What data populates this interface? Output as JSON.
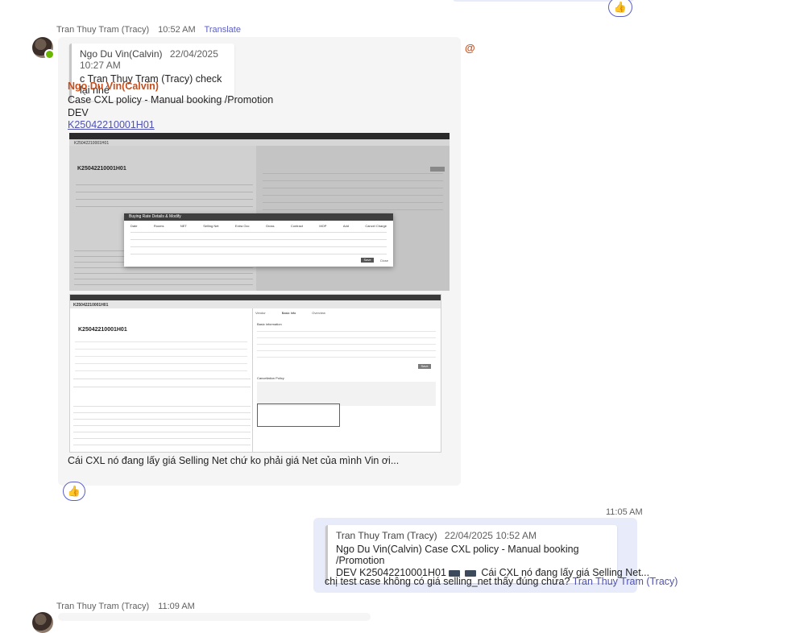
{
  "top_reaction": {
    "emoji": "👍"
  },
  "message1": {
    "author": "Tran Thuy Tram (Tracy)",
    "time": "10:52 AM",
    "translate": "Translate",
    "quote": {
      "author": "Ngo Du Vin(Calvin)",
      "time": "22/04/2025 10:27 AM",
      "text": "c Tran Thuy Tram (Tracy) check lại nhé"
    },
    "mention": "Ngo Du Vin(Calvin)",
    "lines": [
      "Case CXL policy - Manual booking /Promotion",
      "DEV"
    ],
    "link": "K25042210001H01",
    "caption": "Cái CXL nó đang lấy giá Selling Net chứ ko phải giá Net của mình Vin ơi...",
    "reaction": "👍",
    "mention_marker": "@",
    "screenshot1": {
      "booking_id": "K25042210001H01",
      "modal_title": "Buying Rate Details & Modify",
      "columns": [
        "Date",
        "Rooms",
        "NET",
        "Selling Net",
        "Extra Occ",
        "Gross",
        "Contract",
        "MOP",
        "Add",
        "Cancel Charge"
      ],
      "save": "Save",
      "close": "Close"
    },
    "screenshot2": {
      "booking_id": "K25042210001H01",
      "tabs": [
        "Vendor",
        "Basic Info",
        "Overview"
      ],
      "section_basic": "Basic information",
      "section_policy": "Cancellation Policy",
      "save": "Save"
    }
  },
  "message2": {
    "time": "11:05 AM",
    "quote": {
      "author": "Tran Thuy Tram (Tracy)",
      "time": "22/04/2025 10:52 AM",
      "line1": "Ngo Du Vin(Calvin) Case CXL policy - Manual booking /Promotion",
      "line2_prefix": "DEV K25042210001H01",
      "line2_suffix": "Cái CXL nó đang lấy giá Selling Net..."
    },
    "text": "chị test case không có giá selling_net thấy đúng chưa?",
    "mention": "Tran Thuy Tram (Tracy)"
  },
  "message3": {
    "author": "Tran Thuy Tram (Tracy)",
    "time": "11:09 AM"
  }
}
